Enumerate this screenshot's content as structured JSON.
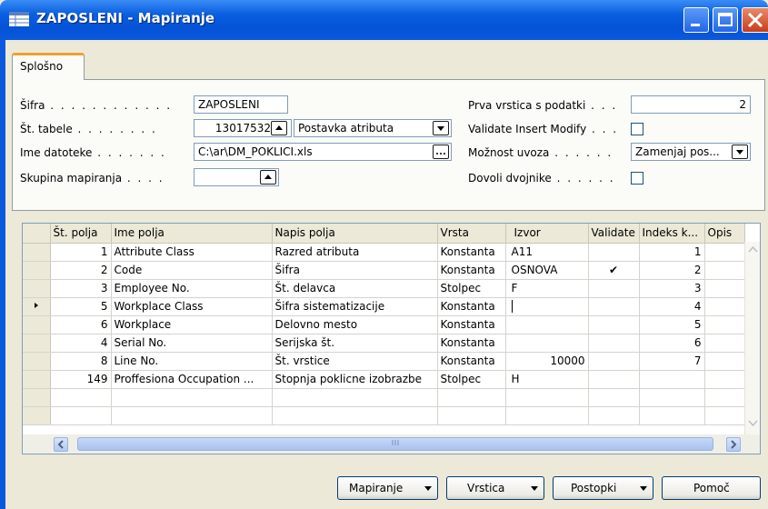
{
  "window": {
    "title": "ZAPOSLENI - Mapiranje",
    "colors": {
      "titlebar": "#0553d6",
      "tab_accent": "#f0a030",
      "panel": "#ece9d8"
    }
  },
  "tabs": [
    {
      "label": "Splošno",
      "selected": true
    }
  ],
  "form": {
    "sifra": {
      "label": "Šifra",
      "value": "ZAPOSLENI"
    },
    "st_tabele": {
      "label": "Št. tabele",
      "value": "13017532",
      "lookup_value": "Postavka atributa"
    },
    "ime_datoteke": {
      "label": "Ime datoteke",
      "value": "C:\\ar\\DM_POKLICI.xls"
    },
    "skupina": {
      "label": "Skupina mapiranja",
      "value": ""
    },
    "prva_vrstica": {
      "label": "Prva vrstica s podatki",
      "value": "2"
    },
    "validate": {
      "label": "Validate Insert Modify",
      "checked": false
    },
    "moznost": {
      "label": "Možnost uvoza",
      "value": "Zamenjaj pos..."
    },
    "dovoli": {
      "label": "Dovoli dvojnike",
      "checked": false
    }
  },
  "grid": {
    "headers": [
      "Št. polja",
      "Ime polja",
      "Napis polja",
      "Vrsta",
      "Izvor",
      "Validate",
      "Indeks k...",
      "Opis"
    ],
    "rows": [
      {
        "st": "1",
        "ime": "Attribute Class",
        "napis": "Razred atributa",
        "vrsta": "Konstanta",
        "izvor": "A11",
        "validate": "",
        "indeks": "1",
        "current": false
      },
      {
        "st": "2",
        "ime": "Code",
        "napis": "Šifra",
        "vrsta": "Konstanta",
        "izvor": "OSNOVA",
        "validate": "✔",
        "indeks": "2",
        "current": false
      },
      {
        "st": "3",
        "ime": "Employee No.",
        "napis": "Št. delavca",
        "vrsta": "Stolpec",
        "izvor": "F",
        "validate": "",
        "indeks": "3",
        "current": false
      },
      {
        "st": "5",
        "ime": "Workplace Class",
        "napis": "Šifra sistematizacije",
        "vrsta": "Konstanta",
        "izvor": "",
        "validate": "",
        "indeks": "4",
        "current": true
      },
      {
        "st": "6",
        "ime": "Workplace",
        "napis": "Delovno mesto",
        "vrsta": "Konstanta",
        "izvor": "",
        "validate": "",
        "indeks": "5",
        "current": false
      },
      {
        "st": "4",
        "ime": "Serial No.",
        "napis": "Serijska št.",
        "vrsta": "Konstanta",
        "izvor": "",
        "validate": "",
        "indeks": "6",
        "current": false
      },
      {
        "st": "8",
        "ime": "Line No.",
        "napis": "Št. vrstice",
        "vrsta": "Konstanta",
        "izvor": "10000",
        "validate": "",
        "indeks": "7",
        "current": false
      },
      {
        "st": "149",
        "ime": "Proffesiona Occupation ...",
        "napis": "Stopnja poklicne izobrazbe",
        "vrsta": "Stolpec",
        "izvor": "H",
        "validate": "",
        "indeks": "",
        "current": false
      }
    ]
  },
  "buttons": {
    "mapiranje": "Mapiranje",
    "vrstica": "Vrstica",
    "postopki": "Postopki",
    "pomoc": "Pomoč"
  },
  "icons": {
    "window": "table-icon",
    "lookup": "arrow-up-icon",
    "dropdown": "arrow-down-icon",
    "ellipsis": "ellipsis-icon",
    "row_pointer": "triangle-right-icon"
  }
}
